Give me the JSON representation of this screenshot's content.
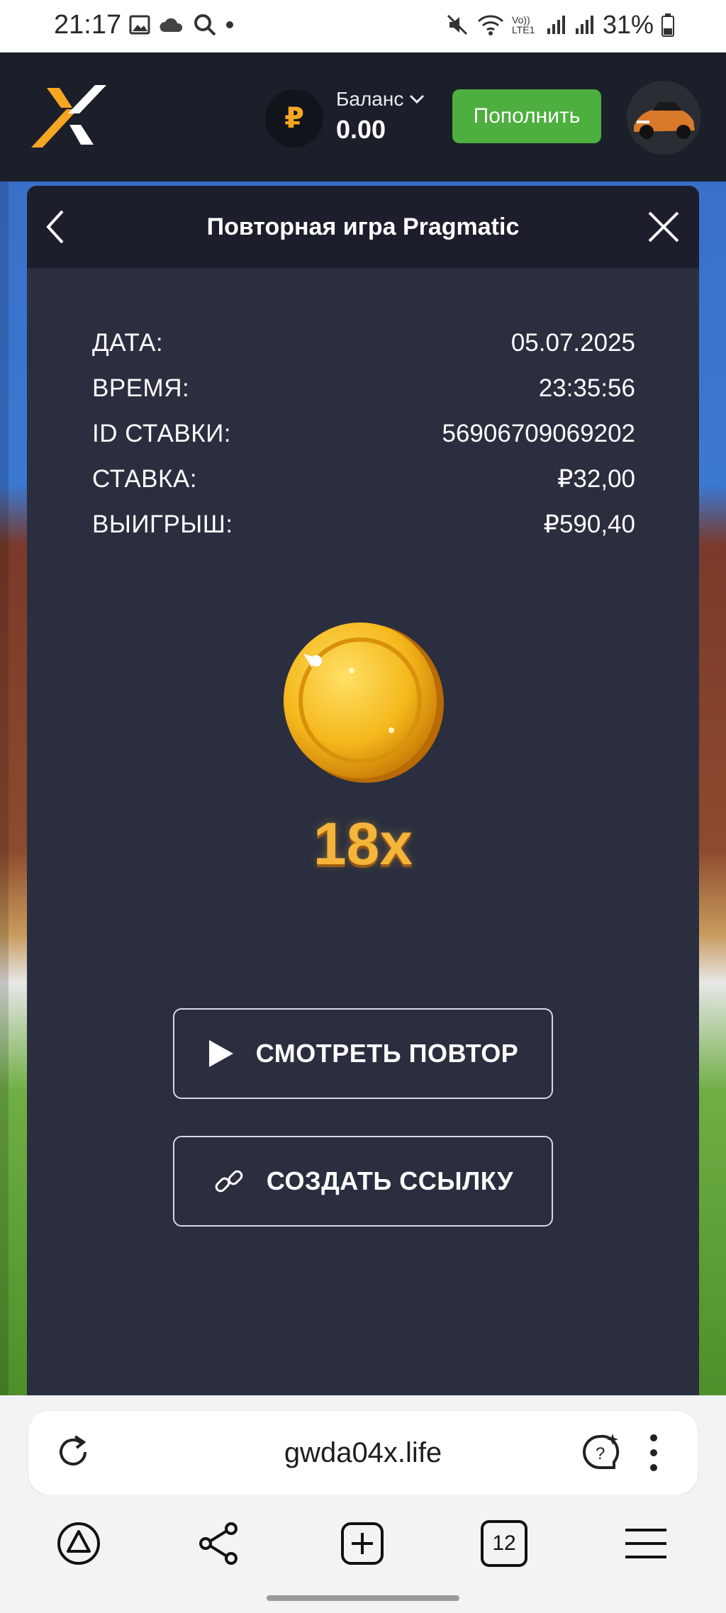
{
  "status_bar": {
    "time": "21:17",
    "battery": "31%",
    "network_label": "Vo)) LTE1"
  },
  "header": {
    "currency_symbol": "₽",
    "balance_label": "Баланс",
    "balance_value": "0.00",
    "topup_label": "Пополнить"
  },
  "modal": {
    "title": "Повторная игра Pragmatic",
    "rows": [
      {
        "label": "ДАТА:",
        "value": "05.07.2025"
      },
      {
        "label": "ВРЕМЯ:",
        "value": "23:35:56"
      },
      {
        "label": "ID СТАВКИ:",
        "value": "56906709069202"
      },
      {
        "label": "СТАВКА:",
        "value": "₽32,00"
      },
      {
        "label": "ВЫИГРЫШ:",
        "value": "₽590,40"
      }
    ],
    "multiplier": "18x",
    "watch_label": "СМОТРЕТЬ ПОВТОР",
    "link_label": "СОЗДАТЬ ССЫЛКУ"
  },
  "browser": {
    "url": "gwda04x.life",
    "tabs_count": "12"
  },
  "colors": {
    "header_bg": "#1b1f2a",
    "modal_bg": "#2a2e3e",
    "accent_green": "#4caf3e",
    "accent_orange": "#f5a623",
    "coin_gold": "#f5b43a"
  }
}
